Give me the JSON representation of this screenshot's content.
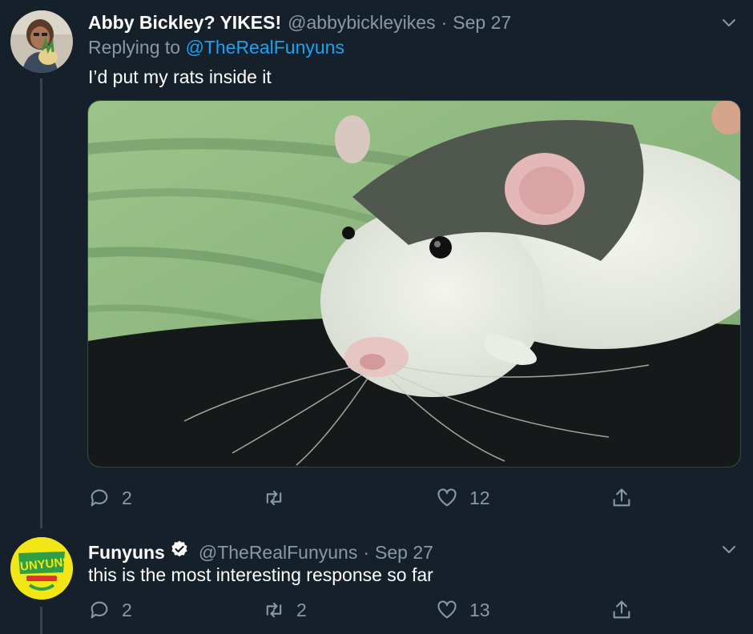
{
  "tweets": [
    {
      "name": "Abby Bickley? YIKES!",
      "handle": "@abbybickleyikes",
      "separator": "·",
      "date": "Sep 27",
      "reply_prefix": "Replying to ",
      "reply_to": "@TheRealFunyuns",
      "text": "I’d put my rats inside it",
      "media_icon": "photo-rat",
      "counts": {
        "reply": "2",
        "retweet": "",
        "like": "12"
      }
    },
    {
      "name": "Funyuns",
      "handle": "@TheRealFunyuns",
      "separator": "·",
      "date": "Sep 27",
      "verified": true,
      "text": "this is the most interesting response so far",
      "avatar_text": "FUNYUNS",
      "counts": {
        "reply": "2",
        "retweet": "2",
        "like": "13"
      }
    }
  ],
  "colors": {
    "background": "#15202b",
    "secondary_text": "#8899a6",
    "link": "#1da1f2",
    "thread_line": "#38444d",
    "verified": "#ffffff",
    "funyuns_yellow": "#f2e616",
    "funyuns_green": "#2f9e44"
  }
}
